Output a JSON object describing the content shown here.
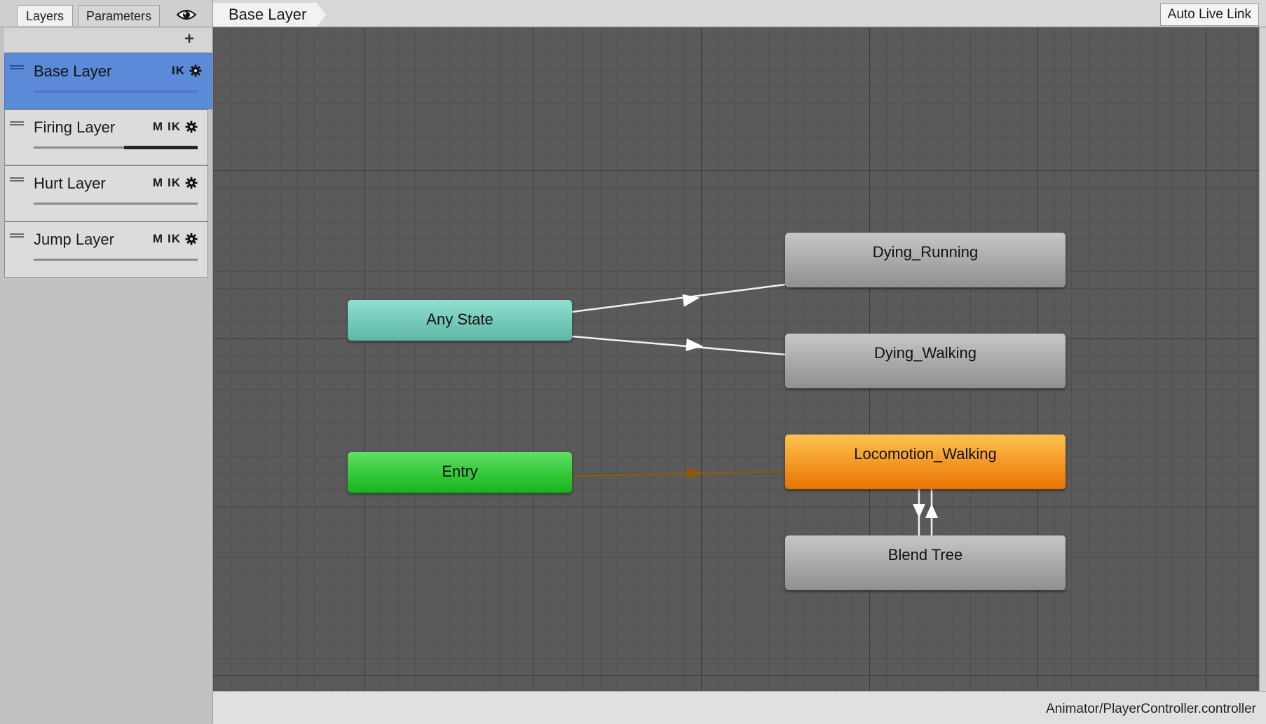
{
  "tabs": {
    "layers_label": "Layers",
    "parameters_label": "Parameters"
  },
  "layers": [
    {
      "name": "Base Layer",
      "flags": [
        "IK"
      ],
      "weight": 0.0,
      "selected": true
    },
    {
      "name": "Firing Layer",
      "flags": [
        "M",
        "IK"
      ],
      "weight": 0.45,
      "selected": false
    },
    {
      "name": "Hurt Layer",
      "flags": [
        "M",
        "IK"
      ],
      "weight": 0.0,
      "selected": false
    },
    {
      "name": "Jump Layer",
      "flags": [
        "M",
        "IK"
      ],
      "weight": 0.0,
      "selected": false
    }
  ],
  "graph": {
    "breadcrumb": "Base Layer",
    "auto_live_link": "Auto Live Link",
    "states": {
      "any_state": "Any State",
      "entry": "Entry",
      "dying_running": "Dying_Running",
      "dying_walking": "Dying_Walking",
      "locomotion_walking": "Locomotion_Walking",
      "blend_tree": "Blend Tree"
    },
    "transitions": [
      {
        "from": "Any State",
        "to": "Dying_Running"
      },
      {
        "from": "Any State",
        "to": "Dying_Walking"
      },
      {
        "from": "Entry",
        "to": "Locomotion_Walking",
        "default": true
      },
      {
        "from": "Locomotion_Walking",
        "to": "Blend Tree"
      },
      {
        "from": "Blend Tree",
        "to": "Locomotion_Walking"
      }
    ]
  },
  "status_bar": {
    "path": "Animator/PlayerController.controller"
  },
  "colors": {
    "selected_layer": "#5b8ad9",
    "any_state": "#72c9b8",
    "entry": "#2fc637",
    "default_state": "#f08a12",
    "state": "#a9a9a9",
    "default_transition": "#8a5a12"
  }
}
